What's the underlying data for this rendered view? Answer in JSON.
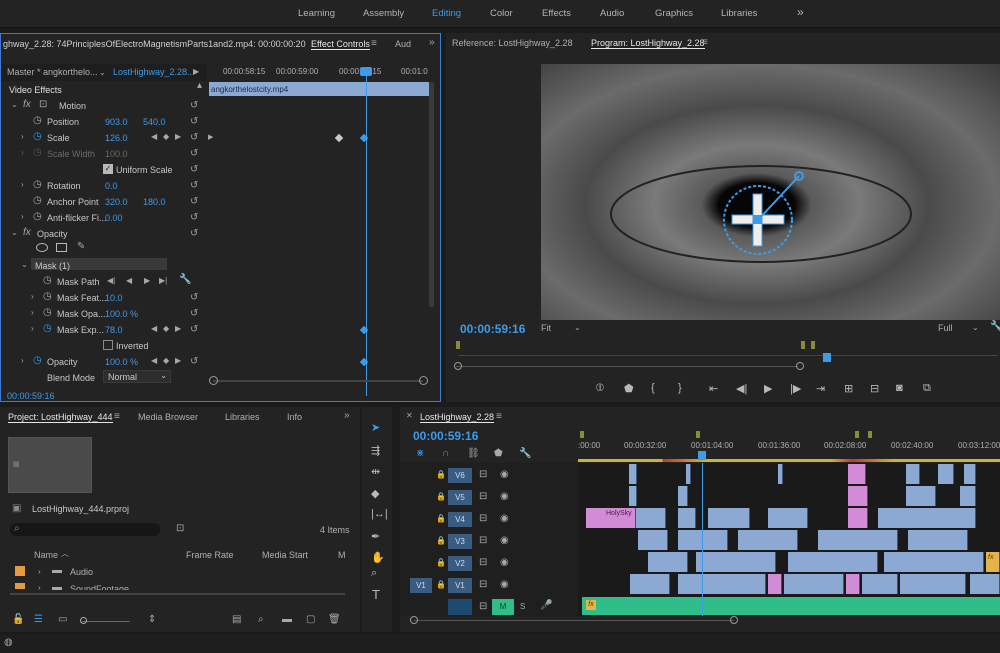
{
  "workspaces": {
    "items": [
      "Learning",
      "Assembly",
      "Editing",
      "Color",
      "Effects",
      "Audio",
      "Graphics",
      "Libraries"
    ],
    "active": "Editing",
    "more": "»"
  },
  "effect_controls": {
    "source_header": "ghway_2.28: 74PrinciplesOfElectroMagnetismParts1and2.mp4: 00:00:00:20",
    "tabs": [
      "Effect Controls",
      "Aud"
    ],
    "master_label": "Master * angkorthelo...",
    "sequence_label": "LostHighway_2.28...",
    "ruler": [
      "00:00:58:15",
      "00:00:59:00",
      "00:00:59:15",
      "00:01:0"
    ],
    "clip_name": "angkorthelostcity.mp4",
    "video_effects": "Video Effects",
    "motion": "Motion",
    "position_label": "Position",
    "position_x": "903.0",
    "position_y": "540.0",
    "scale_label": "Scale",
    "scale_value": "126.0",
    "scale_width_label": "Scale Width",
    "scale_width_value": "100.0",
    "uniform_scale": "Uniform Scale",
    "rotation_label": "Rotation",
    "rotation_value": "0.0",
    "anchor_label": "Anchor Point",
    "anchor_x": "320.0",
    "anchor_y": "180.0",
    "antiflicker_label": "Anti-flicker Fi...",
    "antiflicker_value": "0.00",
    "opacity_group": "Opacity",
    "mask_label": "Mask (1)",
    "mask_path": "Mask Path",
    "mask_feather_label": "Mask Feat...",
    "mask_feather_value": "10.0",
    "mask_opacity_label": "Mask Opa...",
    "mask_opacity_value": "100.0 %",
    "mask_expansion_label": "Mask Exp...",
    "mask_expansion_value": "78.0",
    "inverted": "Inverted",
    "opacity_label": "Opacity",
    "opacity_value": "100.0 %",
    "blend_label": "Blend Mode",
    "blend_value": "Normal",
    "timecode": "00:00:59:16"
  },
  "monitors": {
    "reference_tab": "Reference: LostHighway_2.28",
    "program_tab": "Program: LostHighway_2.28",
    "timecode": "00:00:59:16",
    "fit": "Fit",
    "full": "Full"
  },
  "project": {
    "tabs": [
      "Project: LostHighway_444",
      "Media Browser",
      "Libraries",
      "Info"
    ],
    "file_name": "LostHighway_444.prproj",
    "items_count": "4 Items",
    "columns": [
      "Name",
      "Frame Rate",
      "Media Start",
      "M"
    ],
    "rows": [
      "Audio",
      "SoundFootage"
    ]
  },
  "timeline": {
    "tab": "LostHighway_2.28",
    "timecode": "00:00:59:16",
    "ruler": [
      ":00:00",
      "00:00:32:00",
      "00:01:04:00",
      "00:01:36:00",
      "00:02:08:00",
      "00:02:40:00",
      "00:03:12:00"
    ],
    "tracks": [
      "V6",
      "V5",
      "V4",
      "V3",
      "V2",
      "V1"
    ],
    "source_track": "V1",
    "audio_m": "M",
    "audio_s": "S",
    "clip_label": "HolySky",
    "fx_label": "fx"
  },
  "colors": {
    "accent": "#3d9be9",
    "video_clip": "#8ca9d3",
    "pink_clip": "#d48bd5",
    "audio_clip": "#2fbd8a"
  }
}
